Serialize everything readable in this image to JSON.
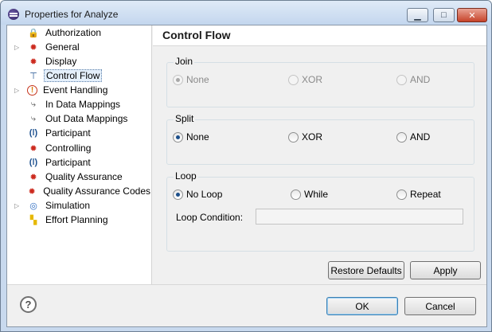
{
  "window": {
    "title": "Properties for Analyze"
  },
  "titlebar": {
    "minimize_glyph": "▁",
    "maximize_glyph": "□",
    "close_glyph": "✕"
  },
  "tree": {
    "items": [
      {
        "label": "Authorization",
        "icon": "lock-icon",
        "glyph": "🔒",
        "expandable": false
      },
      {
        "label": "General",
        "icon": "gear-icon",
        "glyph": "✹",
        "expandable": true
      },
      {
        "label": "Display",
        "icon": "gear-icon",
        "glyph": "✹",
        "expandable": false
      },
      {
        "label": "Control Flow",
        "icon": "flow-icon",
        "glyph": "⊤",
        "expandable": false,
        "selected": true
      },
      {
        "label": "Event Handling",
        "icon": "warning-icon",
        "glyph": "!",
        "expandable": true
      },
      {
        "label": "In Data Mappings",
        "icon": "mapping-icon",
        "glyph": "⤷",
        "expandable": false
      },
      {
        "label": "Out Data Mappings",
        "icon": "mapping-icon",
        "glyph": "⤷",
        "expandable": false
      },
      {
        "label": "Participant",
        "icon": "participant-icon",
        "glyph": "(ǀ)",
        "expandable": false
      },
      {
        "label": "Controlling",
        "icon": "gear-icon",
        "glyph": "✹",
        "expandable": false
      },
      {
        "label": "Participant",
        "icon": "participant-icon",
        "glyph": "(ǀ)",
        "expandable": false
      },
      {
        "label": "Quality Assurance",
        "icon": "gear-icon",
        "glyph": "✹",
        "expandable": false
      },
      {
        "label": "Quality Assurance Codes",
        "icon": "gear-icon",
        "glyph": "✹",
        "expandable": false
      },
      {
        "label": "Simulation",
        "icon": "simulation-icon",
        "glyph": "◎",
        "expandable": true
      },
      {
        "label": "Effort Planning",
        "icon": "effort-icon",
        "glyph": "▚",
        "expandable": false
      }
    ],
    "expand_glyph": "▷"
  },
  "page": {
    "title": "Control Flow"
  },
  "join": {
    "label": "Join",
    "options": [
      {
        "label": "None",
        "checked": true
      },
      {
        "label": "XOR",
        "checked": false
      },
      {
        "label": "AND",
        "checked": false
      }
    ]
  },
  "split": {
    "label": "Split",
    "options": [
      {
        "label": "None",
        "checked": true
      },
      {
        "label": "XOR",
        "checked": false
      },
      {
        "label": "AND",
        "checked": false
      }
    ]
  },
  "loop": {
    "label": "Loop",
    "options": [
      {
        "label": "No Loop",
        "checked": true
      },
      {
        "label": "While",
        "checked": false
      },
      {
        "label": "Repeat",
        "checked": false
      }
    ],
    "condition_label": "Loop Condition:",
    "condition_value": ""
  },
  "buttons": {
    "restore_defaults": "Restore Defaults",
    "apply": "Apply",
    "ok": "OK",
    "cancel": "Cancel",
    "help": "?"
  }
}
